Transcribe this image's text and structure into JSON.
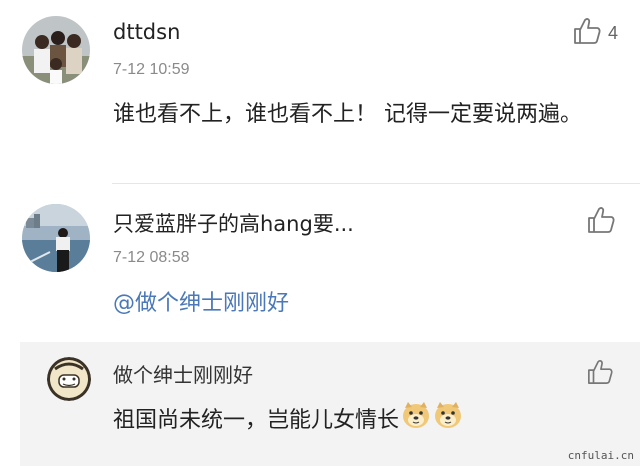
{
  "comments": [
    {
      "username": "dttdsn",
      "timestamp": "7-12 10:59",
      "like_count": "4",
      "text": "谁也看不上，谁也看不上！ 记得一定要说两遍。"
    },
    {
      "username": "只爱蓝胖子的高hang要...",
      "timestamp": "7-12 08:58",
      "like_count": "",
      "text": "@做个绅士刚刚好"
    }
  ],
  "reply": {
    "username": "做个绅士刚刚好",
    "text": "祖国尚未统一，岂能儿女情长",
    "like_count": ""
  },
  "icons": {
    "like": "thumbs-up-icon",
    "emoji": "doge-emoji-icon"
  },
  "colors": {
    "mention": "#4a78b8",
    "reply_bg": "#f3f3f3",
    "meta_text": "#8a8a8a"
  },
  "watermark": "cnfulai.cn"
}
